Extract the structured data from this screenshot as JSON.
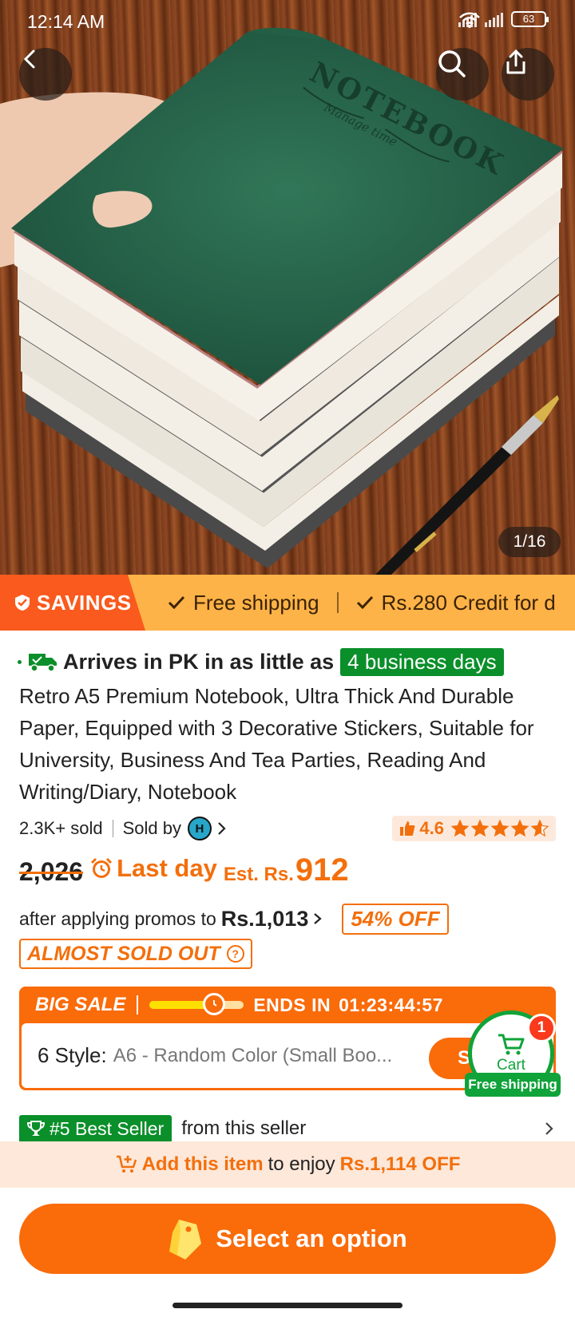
{
  "status_bar": {
    "time": "12:14 AM",
    "battery": "63"
  },
  "hero": {
    "image_counter": "1/16",
    "book_cover_title": "NOTEBOOK",
    "book_cover_subtitle": "Manage time"
  },
  "savings": {
    "badge": "SAVINGS",
    "items": [
      "Free shipping",
      "Rs.280 Credit for d"
    ]
  },
  "delivery": {
    "prefix": "Arrives in PK in as little as",
    "days": "4 business days"
  },
  "product": {
    "title": "Retro A5 Premium Notebook, Ultra Thick And Durable Paper, Equipped with 3 Decorative Stickers, Suitable for University, Business And Tea Parties, Reading And Writing/Diary, Notebook",
    "sold": "2.3K+ sold",
    "sold_by": "Sold by",
    "rating": "4.6",
    "rating_stars": 4.6
  },
  "price": {
    "original": "2,026",
    "last_day": "Last day",
    "est_label": "Est. Rs.",
    "est_value": "912",
    "promo_prefix": "after applying promos to",
    "promo_price": "Rs.1,013",
    "off_badge": "54% OFF",
    "almost_sold_out": "ALMOST SOLD OUT"
  },
  "big_sale": {
    "label": "BIG SALE",
    "ends_label": "ENDS IN",
    "countdown": "01:23:44:57",
    "progress": 0.68,
    "style_label": "6 Style:",
    "style_value": "A6 - Random Color (Small Boo...",
    "select_label": "Se"
  },
  "cart": {
    "label": "Cart",
    "count": "1",
    "free_shipping": "Free shipping"
  },
  "best_seller": {
    "badge": "#5 Best Seller",
    "text": "from this seller"
  },
  "promo_banner": {
    "part1": "Add this item",
    "part2": "to enjoy",
    "part3": "Rs.1,114 OFF"
  },
  "cta": {
    "label": "Select an option"
  },
  "colors": {
    "accent": "#fa6b0a",
    "green": "#0a8f2a",
    "savings_bg": "#fdb347",
    "cover_green": "#235f45"
  }
}
